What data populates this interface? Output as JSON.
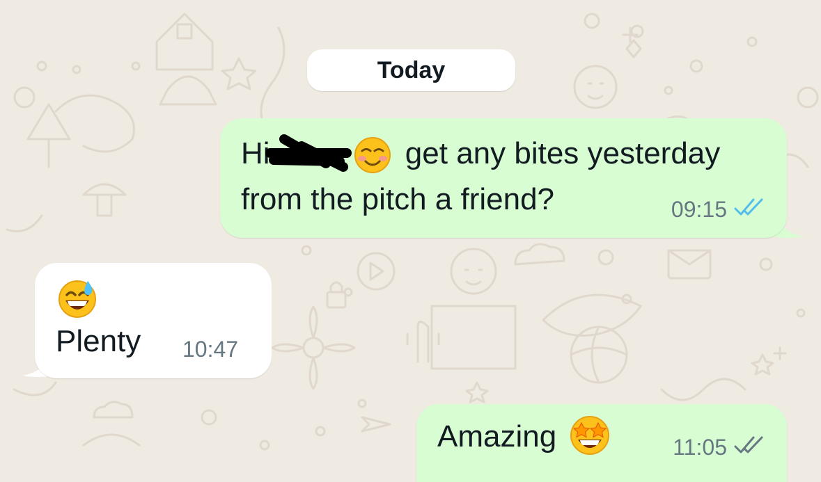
{
  "chat": {
    "date_label": "Today",
    "messages": [
      {
        "direction": "outgoing",
        "greeting": "Hi",
        "line1": "get any bites yesterday",
        "line2": "from the pitch a friend?",
        "time": "09:15",
        "status": "read"
      },
      {
        "direction": "incoming",
        "emoji": "grinning-face-with-sweat-emoji",
        "text": "Plenty",
        "time": "10:47"
      },
      {
        "direction": "outgoing",
        "text": "Amazing",
        "emoji": "star-struck-emoji",
        "time": "11:05",
        "status": "delivered"
      }
    ]
  },
  "colors": {
    "wallpaper": "#efeae2",
    "outgoing_bubble": "#d9fdd3",
    "incoming_bubble": "#ffffff",
    "read_tick": "#53bdeb",
    "delivered_tick": "#667781",
    "timestamp": "#667781"
  }
}
